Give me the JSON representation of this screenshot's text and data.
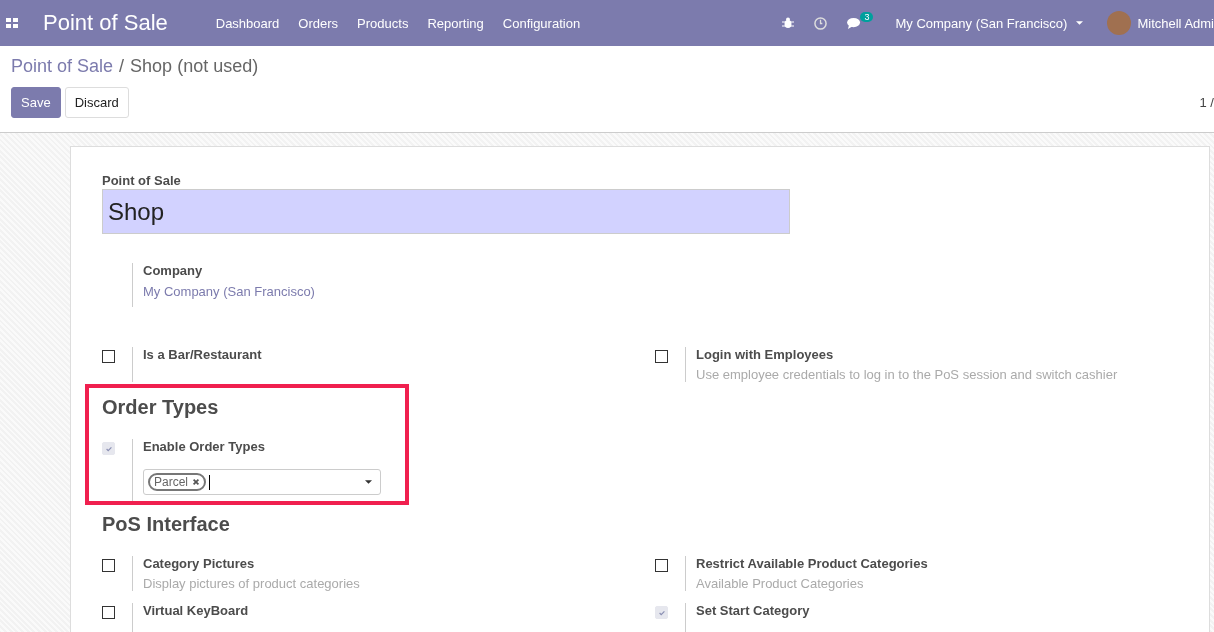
{
  "navbar": {
    "app_title": "Point of Sale",
    "menu": [
      {
        "label": "Dashboard"
      },
      {
        "label": "Orders"
      },
      {
        "label": "Products"
      },
      {
        "label": "Reporting"
      },
      {
        "label": "Configuration"
      }
    ],
    "messages_badge": "3",
    "company": "My Company (San Francisco)",
    "user": "Mitchell Admi"
  },
  "breadcrumb": {
    "parent": "Point of Sale",
    "separator": "/",
    "current": "Shop (not used)"
  },
  "buttons": [
    {
      "label": "Save",
      "kind": "primary"
    },
    {
      "label": "Discard",
      "kind": "secondary"
    }
  ],
  "pager": "1 /",
  "form": {
    "name_label": "Point of Sale",
    "name_value": "Shop",
    "company_label": "Company",
    "company_value": "My Company (San Francisco)",
    "top_settings": [
      {
        "label": "Is a Bar/Restaurant",
        "checked": false
      },
      {
        "label": "Login with Employees",
        "description": "Use employee credentials to log in to the PoS session and switch cashier",
        "checked": false
      }
    ],
    "sections": [
      {
        "title": "Order Types",
        "highlighted": true,
        "settings": [
          {
            "label": "Enable Order Types",
            "checked": true,
            "tags": [
              "Parcel"
            ]
          }
        ]
      },
      {
        "title": "PoS Interface",
        "highlighted": false,
        "settings": [
          {
            "label": "Category Pictures",
            "description": "Display pictures of product categories",
            "checked": false
          },
          {
            "label": "Restrict Available Product Categories",
            "description": "Available Product Categories",
            "checked": false
          },
          {
            "label": "Virtual KeyBoard",
            "checked": false
          },
          {
            "label": "Set Start Category",
            "checked": true
          }
        ]
      }
    ]
  }
}
